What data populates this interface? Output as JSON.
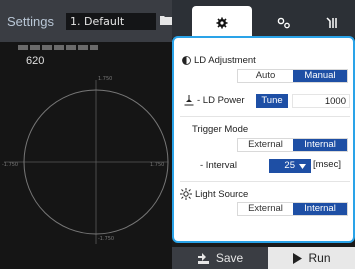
{
  "header": {
    "settings_label": "Settings",
    "profile_value": "1. Default"
  },
  "readout": {
    "value": "620"
  },
  "plot": {
    "tick_top": "1.750",
    "tick_left": "-1.750",
    "tick_right": "1.750",
    "tick_bottom": "-1.750"
  },
  "tabs": [
    {
      "name": "tab-settings",
      "icon": "gear-icon",
      "active": true
    },
    {
      "name": "tab-options",
      "icon": "gear-pair-icon",
      "active": false
    },
    {
      "name": "tab-tools",
      "icon": "tools-icon",
      "active": false
    }
  ],
  "panel": {
    "ld_adjustment": {
      "title": "LD Adjustment",
      "options": [
        "Auto",
        "Manual"
      ],
      "selected": "Manual"
    },
    "ld_power": {
      "title": "- LD Power",
      "tune_label": "Tune",
      "value": "1000"
    },
    "trigger_mode": {
      "title": "Trigger Mode",
      "options": [
        "External",
        "Internal"
      ],
      "selected": "Internal"
    },
    "interval": {
      "label": "- Interval",
      "value": "25",
      "unit": "[msec]"
    },
    "light_source": {
      "title": "Light Source",
      "options": [
        "External",
        "Internal"
      ],
      "selected": "Internal"
    }
  },
  "actions": {
    "save_label": "Save",
    "run_label": "Run"
  },
  "colors": {
    "accent_blue": "#1e4fa5",
    "focus_border": "#2aa3e8",
    "dark_bg": "#151515"
  }
}
